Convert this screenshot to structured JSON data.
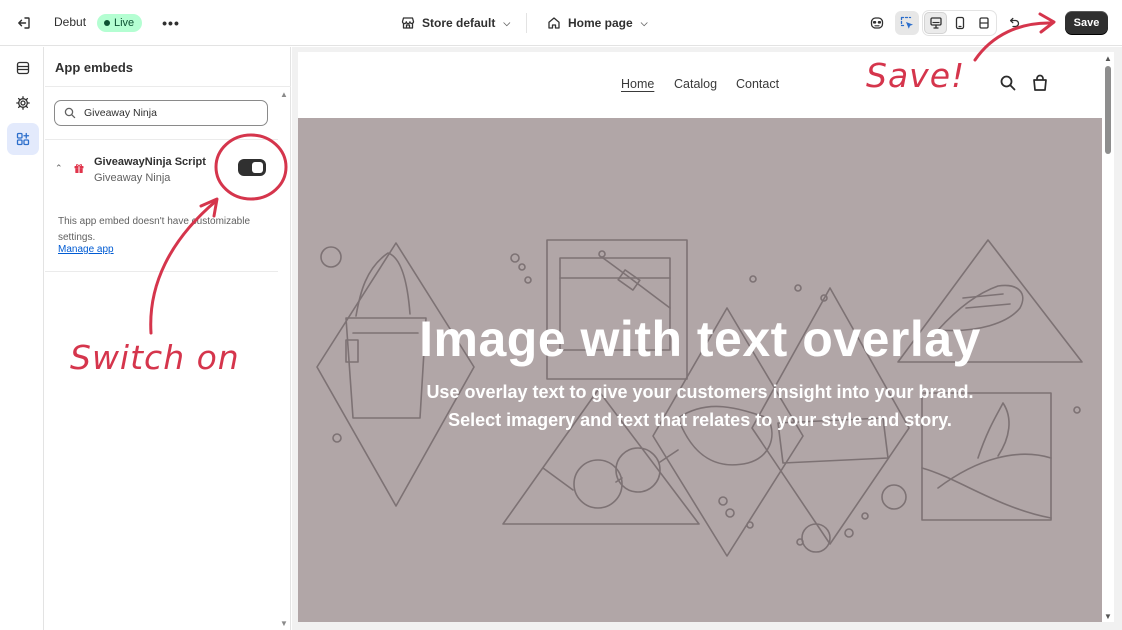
{
  "topbar": {
    "theme_name": "Debut",
    "live_label": "Live",
    "more_label": "•••",
    "store_label": "Store default",
    "page_label": "Home page",
    "save_label": "Save"
  },
  "panel": {
    "title": "App embeds",
    "search_value": "Giveaway Ninja",
    "embed": {
      "name": "GiveawayNinja Script",
      "app": "Giveaway Ninja",
      "enabled": true,
      "description": "This app embed doesn't have customizable settings.",
      "manage_label": "Manage app"
    }
  },
  "preview": {
    "nav": [
      "Home",
      "Catalog",
      "Contact"
    ],
    "hero_title": "Image with text overlay",
    "hero_text": "Use overlay text to give your customers insight into your brand. Select imagery and text that relates to your style and story."
  },
  "annotations": {
    "save": "Save!",
    "switch": "Switch on"
  },
  "colors": {
    "accent": "#d5354c",
    "hero_bg": "#b1a6a7",
    "live_bg": "#b4fed2",
    "primary_button": "#303030",
    "link": "#005bd3"
  }
}
